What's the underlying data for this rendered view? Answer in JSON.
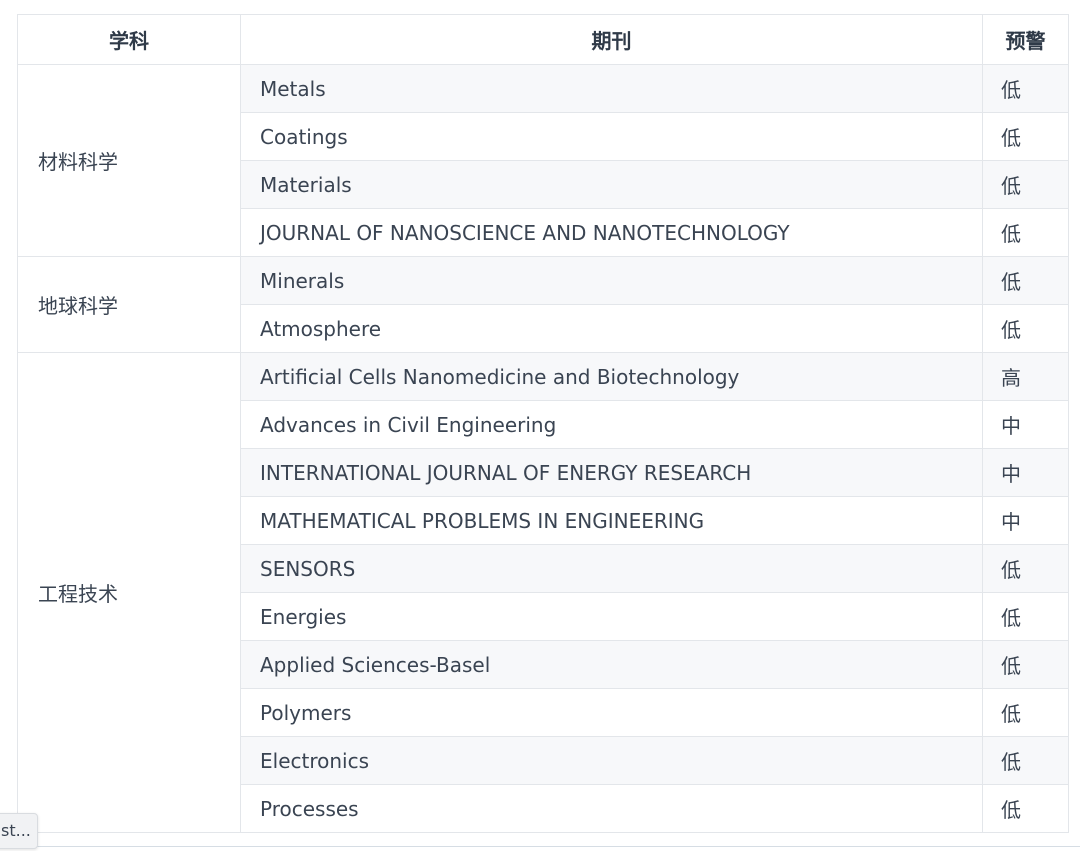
{
  "table": {
    "headers": [
      "学科",
      "期刊",
      "预警"
    ],
    "groups": [
      {
        "subject": "材料科学",
        "rows": [
          {
            "journal": "Metals",
            "warning": "低"
          },
          {
            "journal": "Coatings",
            "warning": "低"
          },
          {
            "journal": "Materials",
            "warning": "低"
          },
          {
            "journal": "JOURNAL OF NANOSCIENCE AND NANOTECHNOLOGY",
            "warning": "低"
          }
        ]
      },
      {
        "subject": "地球科学",
        "rows": [
          {
            "journal": "Minerals",
            "warning": "低"
          },
          {
            "journal": "Atmosphere",
            "warning": "低"
          }
        ]
      },
      {
        "subject": "工程技术",
        "rows": [
          {
            "journal": "Artificial Cells Nanomedicine and Biotechnology",
            "warning": "高"
          },
          {
            "journal": "Advances in Civil Engineering",
            "warning": "中"
          },
          {
            "journal": "INTERNATIONAL JOURNAL OF ENERGY RESEARCH",
            "warning": "中"
          },
          {
            "journal": "MATHEMATICAL PROBLEMS IN ENGINEERING",
            "warning": "中"
          },
          {
            "journal": "SENSORS",
            "warning": "低"
          },
          {
            "journal": "Energies",
            "warning": "低"
          },
          {
            "journal": "Applied Sciences-Basel",
            "warning": "低"
          },
          {
            "journal": "Polymers",
            "warning": "低"
          },
          {
            "journal": "Electronics",
            "warning": "低"
          },
          {
            "journal": "Processes",
            "warning": "低"
          }
        ]
      }
    ]
  },
  "tooltip": {
    "text": "st..."
  },
  "colors": {
    "border": "#e3e6ea",
    "row_shade": "#f7f8fa",
    "text": "#3a4452"
  }
}
